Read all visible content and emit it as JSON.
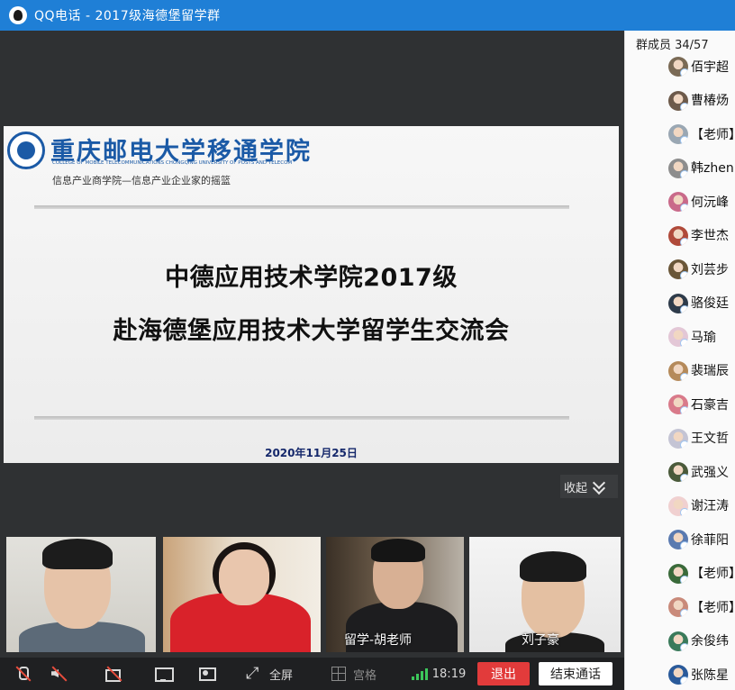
{
  "window": {
    "title": "QQ电话  -  2017级海德堡留学群"
  },
  "slide": {
    "college_name": "重庆邮电大学移通学院",
    "college_name_en": "COLLEGE OF MOBILE TELECOMMUNICATIONS CHONGQING UNIVERSITY OF POSTS AND TELECOM",
    "slogan": "信息产业商学院—信息产业企业家的摇篮",
    "heading_line1": "中德应用技术学院2017级",
    "heading_line2": "赴海德堡应用技术大学留学生交流会",
    "date": "2020年11月25日"
  },
  "collapse_label": "收起",
  "video_tiles": [
    {
      "caption": ""
    },
    {
      "caption": ""
    },
    {
      "caption": "留学-胡老师"
    },
    {
      "caption": "刘子豪"
    }
  ],
  "controls": {
    "fullscreen_label": "全屏",
    "grid_label": "宫格",
    "time": "18:19",
    "leave_label": "退出",
    "end_call_label": "结束通话"
  },
  "members": {
    "header": "群成员 34/57",
    "list": [
      {
        "name": "佰宇超",
        "color": "#7a6a55"
      },
      {
        "name": "曹椿炀",
        "color": "#6d5a4a"
      },
      {
        "name": "【老师】",
        "color": "#9aa7b3"
      },
      {
        "name": "韩zhen",
        "color": "#8d8d8d"
      },
      {
        "name": "何沅峰",
        "color": "#c96a8a"
      },
      {
        "name": "李世杰",
        "color": "#b04a3a"
      },
      {
        "name": "刘芸步",
        "color": "#6a5638"
      },
      {
        "name": "骆俊廷",
        "color": "#2e3b4a"
      },
      {
        "name": "马瑜",
        "color": "#e3c7d6"
      },
      {
        "name": "裴瑞辰",
        "color": "#b58a5a"
      },
      {
        "name": "石豪吉",
        "color": "#d97a8a"
      },
      {
        "name": "王文哲",
        "color": "#c4c4d4"
      },
      {
        "name": "武强义",
        "color": "#4a5a3a"
      },
      {
        "name": "谢汪涛",
        "color": "#f0d0d0"
      },
      {
        "name": "徐菲阳",
        "color": "#5a7ab0"
      },
      {
        "name": "【老师】",
        "color": "#3a6a3a"
      },
      {
        "name": "【老师】",
        "color": "#c98a7a"
      },
      {
        "name": "余俊纬",
        "color": "#3a7a5a"
      },
      {
        "name": "张陈星",
        "color": "#2a5a9a"
      }
    ]
  },
  "colors": {
    "title_bar": "#1f7fd6",
    "leave_button": "#e23b3b",
    "signal": "#3cc75a",
    "slide_heading_date": "#15286b",
    "college_blue": "#1b5aa6"
  }
}
